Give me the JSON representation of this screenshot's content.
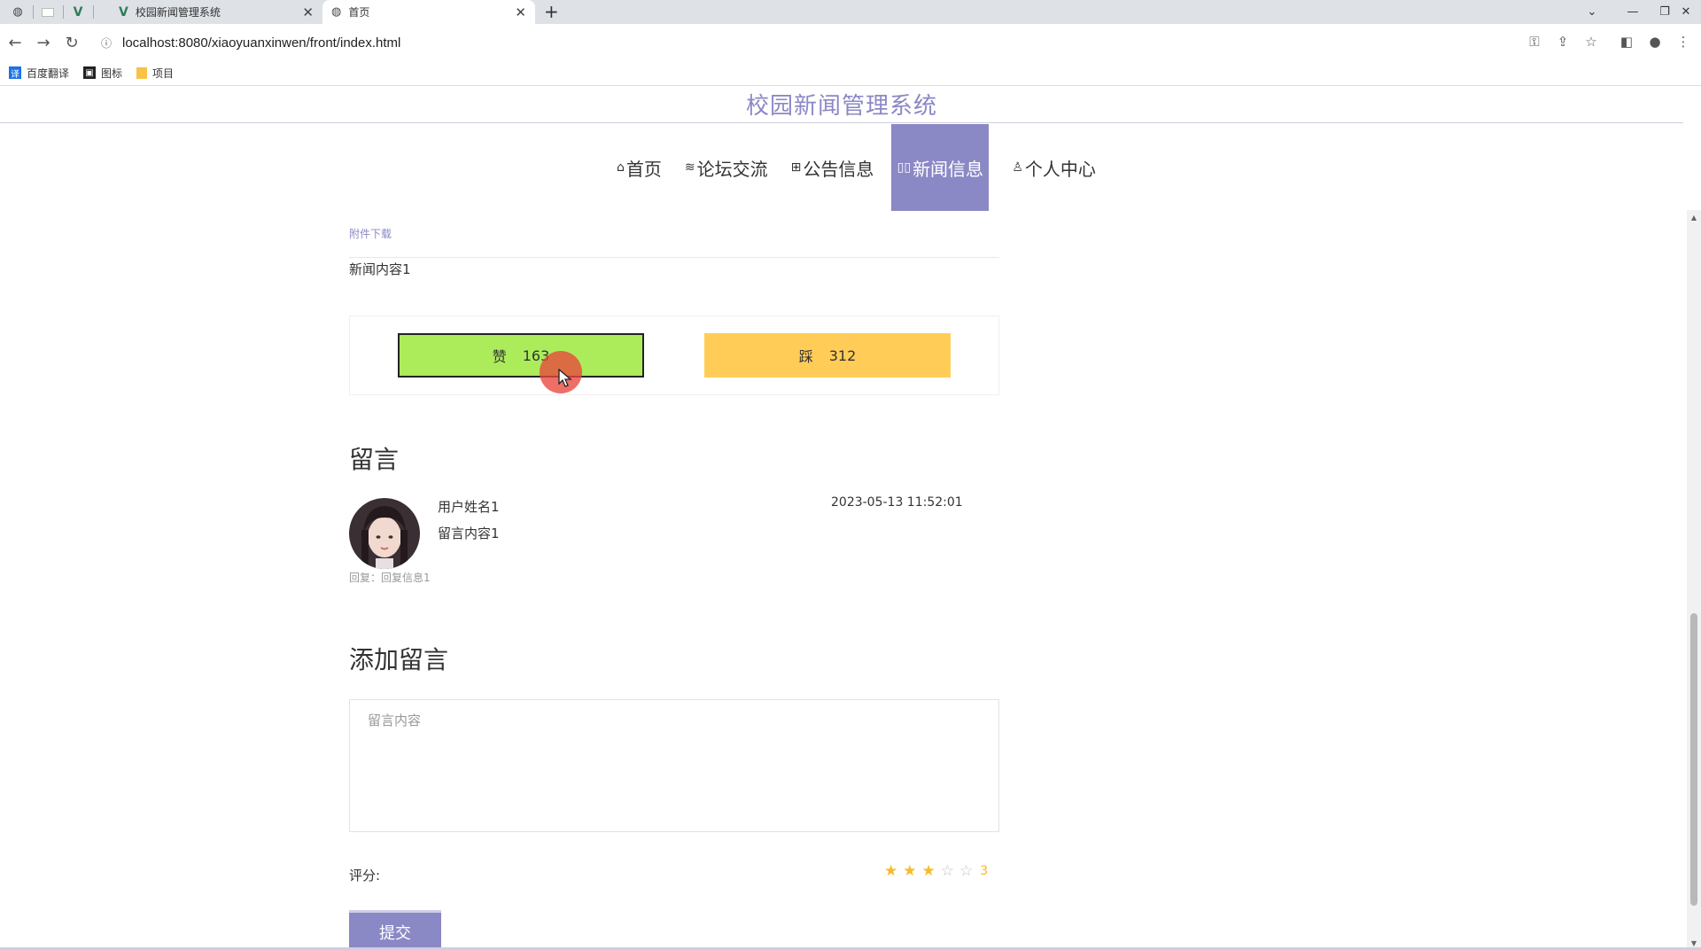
{
  "browser": {
    "tabs": [
      {
        "title": "校园新闻管理系统",
        "icon": "vue-icon",
        "active": false
      },
      {
        "title": "首页",
        "icon": "globe-icon",
        "active": true
      }
    ],
    "url": "localhost:8080/xiaoyuanxinwen/front/index.html",
    "bookmarks": [
      {
        "label": "百度翻译",
        "icon": "translate-icon",
        "color": "#1a73e8"
      },
      {
        "label": "图标",
        "icon": "image-icon",
        "color": "#222222"
      },
      {
        "label": "项目",
        "icon": "folder-icon",
        "color": "#f6c344"
      }
    ]
  },
  "site": {
    "title": "校园新闻管理系统",
    "accent": "#8b88c6"
  },
  "nav": [
    {
      "label": "首页",
      "icon": "home-icon",
      "active": false
    },
    {
      "label": "论坛交流",
      "icon": "layers-icon",
      "active": false
    },
    {
      "label": "公告信息",
      "icon": "gift-icon",
      "active": false
    },
    {
      "label": "新闻信息",
      "icon": "news-icon",
      "active": true
    },
    {
      "label": "个人中心",
      "icon": "user-icon",
      "active": false
    }
  ],
  "news": {
    "attachment_link": "附件下载",
    "content": "新闻内容1"
  },
  "votes": {
    "like_label": "赞",
    "like_count": "163",
    "like_color": "#acec5b",
    "dislike_label": "踩",
    "dislike_count": "312",
    "dislike_color": "#ffcd57"
  },
  "comments": {
    "heading": "留言",
    "items": [
      {
        "user": "用户姓名1",
        "text": "留言内容1",
        "time": "2023-05-13 11:52:01",
        "reply": "回复：回复信息1"
      }
    ]
  },
  "add_comment": {
    "heading": "添加留言",
    "placeholder": "留言内容",
    "rating_label": "评分:",
    "rating_value": 3,
    "rating_max": 5,
    "rating_text": "3",
    "submit_label": "提交"
  }
}
